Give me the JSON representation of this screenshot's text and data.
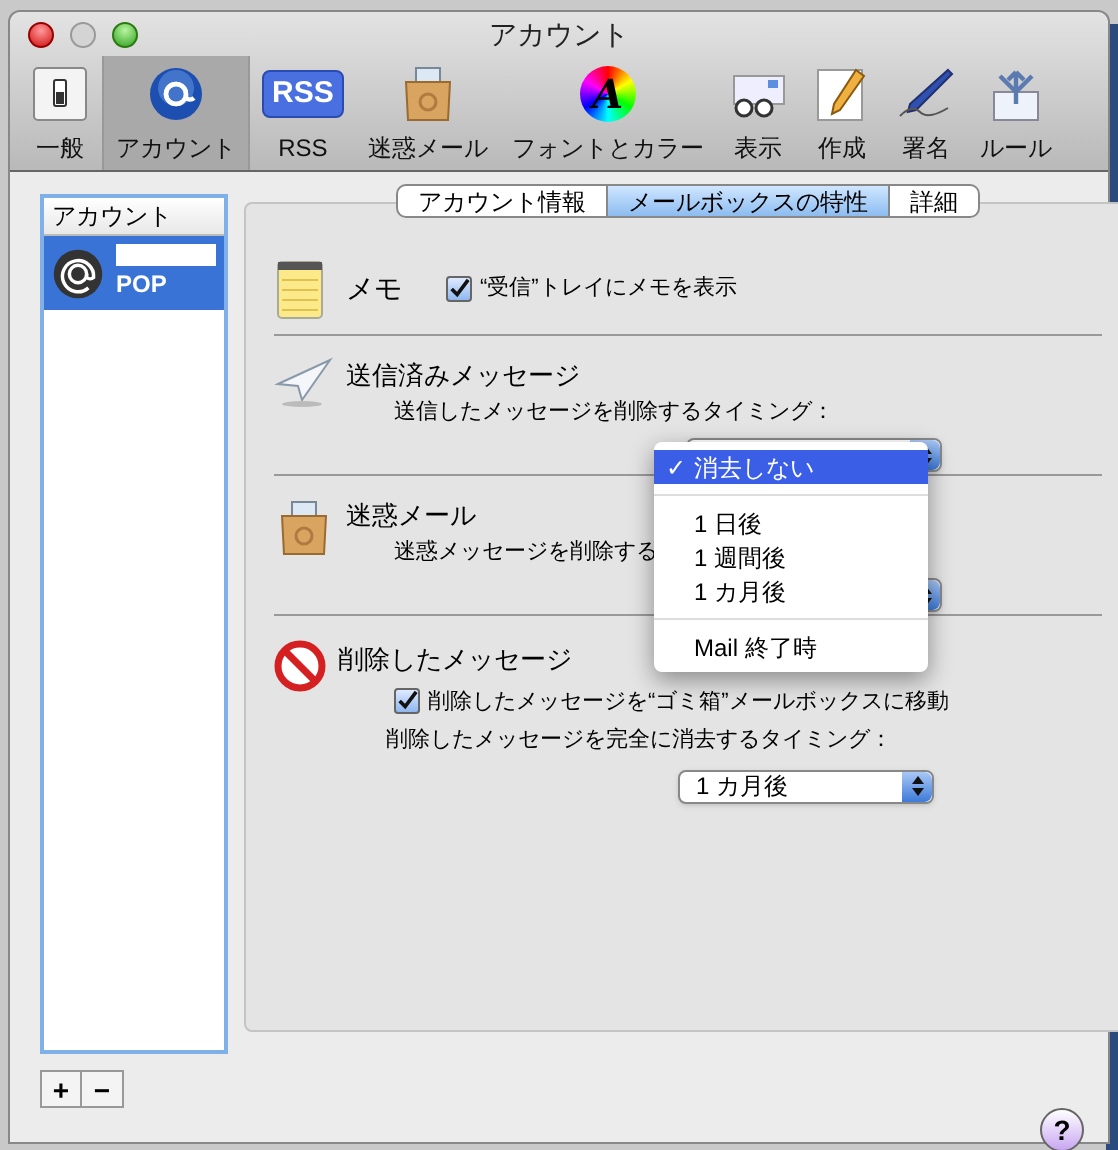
{
  "window": {
    "title": "アカウント"
  },
  "toolbar": [
    {
      "label": "一般",
      "selected": false
    },
    {
      "label": "アカウント",
      "selected": true
    },
    {
      "label": "RSS",
      "selected": false,
      "icon_text": "RSS"
    },
    {
      "label": "迷惑メール",
      "selected": false
    },
    {
      "label": "フォントとカラー",
      "selected": false,
      "icon_text": "A"
    },
    {
      "label": "表示",
      "selected": false
    },
    {
      "label": "作成",
      "selected": false
    },
    {
      "label": "署名",
      "selected": false
    },
    {
      "label": "ルール",
      "selected": false
    }
  ],
  "sidebar": {
    "header": "アカウント",
    "items": [
      {
        "type": "POP",
        "selected": true
      }
    ]
  },
  "tabs": [
    {
      "label": "アカウント情報",
      "selected": false
    },
    {
      "label": "メールボックスの特性",
      "selected": true
    },
    {
      "label": "詳細",
      "selected": false
    }
  ],
  "memo": {
    "title": "メモ",
    "checkbox": {
      "label": "“受信”トレイにメモを表示",
      "checked": true
    }
  },
  "sent": {
    "title": "送信済みメッセージ",
    "prompt": "送信したメッセージを削除するタイミング："
  },
  "junk": {
    "title": "迷惑メール",
    "prompt": "迷惑メッセージを削除する"
  },
  "deleted": {
    "title": "削除したメッセージ",
    "checkbox": {
      "label": "削除したメッセージを“ゴミ箱”メールボックスに移動",
      "checked": true
    },
    "prompt": "削除したメッセージを完全に消去するタイミング：",
    "popup": "1 カ月後"
  },
  "menu": {
    "items": [
      {
        "label": "消去しない",
        "selected": true,
        "check": "✓"
      },
      {
        "label": "1 日後",
        "selected": false
      },
      {
        "label": "1 週間後",
        "selected": false
      },
      {
        "label": "1 カ月後",
        "selected": false
      },
      {
        "label": "Mail 終了時",
        "selected": false
      }
    ]
  },
  "buttons": {
    "add": "+",
    "remove": "−",
    "help": "?"
  }
}
